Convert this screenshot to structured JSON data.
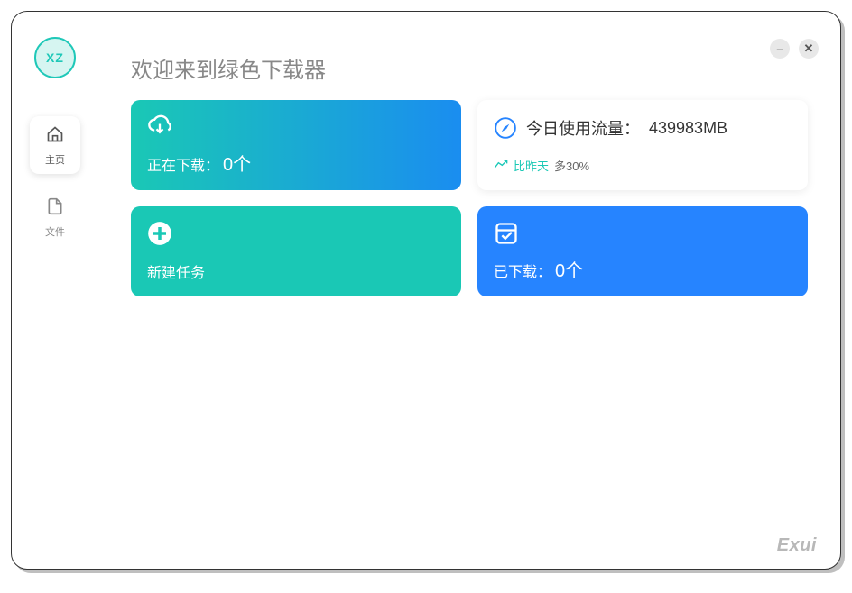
{
  "logo": "XZ",
  "window": {
    "minimize": "–",
    "close": "✕"
  },
  "sidebar": {
    "items": [
      {
        "label": "主页"
      },
      {
        "label": "文件"
      }
    ]
  },
  "main": {
    "title": "欢迎来到绿色下载器"
  },
  "cards": {
    "downloading": {
      "label": "正在下载：",
      "count": "0个"
    },
    "traffic": {
      "label": "今日使用流量：",
      "value": "439983MB",
      "compare_label": "比昨天",
      "compare_value": "多30%"
    },
    "newtask": {
      "label": "新建任务"
    },
    "downloaded": {
      "label": "已下载：",
      "count": "0个"
    }
  },
  "brand": "Exui"
}
